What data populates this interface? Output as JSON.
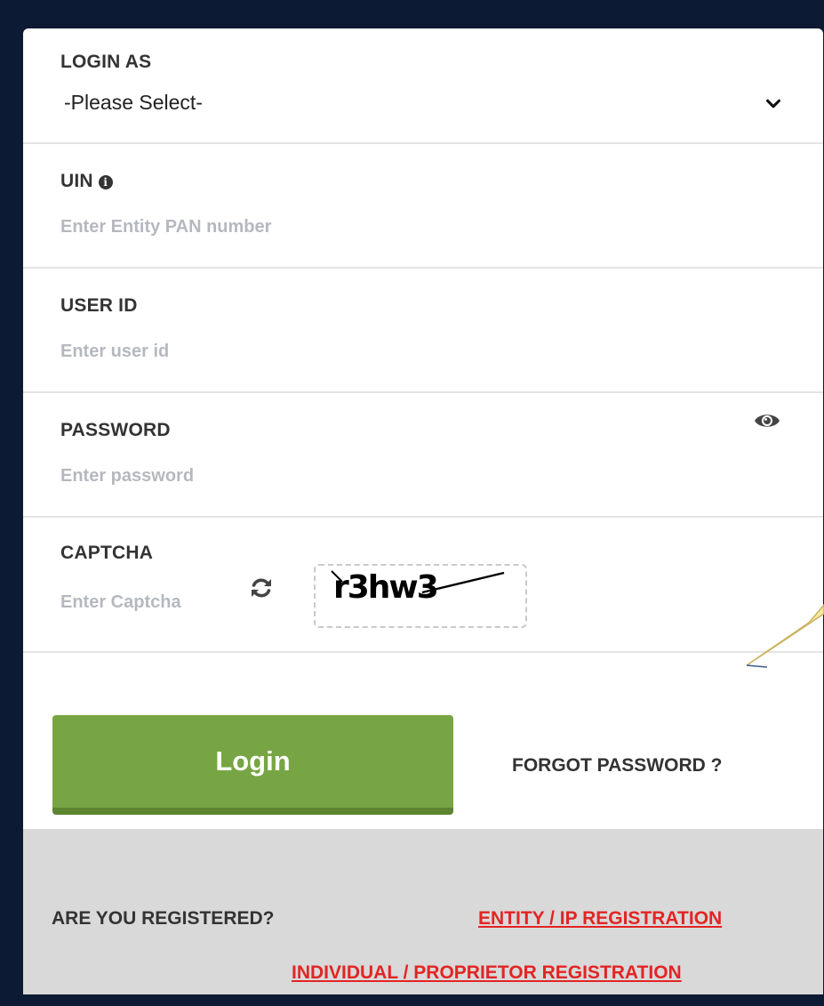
{
  "login_as": {
    "label": "LOGIN AS",
    "selected": "-Please Select-",
    "chevron_icon": "chevron-down-icon"
  },
  "uin": {
    "label": "UIN",
    "info_icon": "info-circle-icon",
    "placeholder": "Enter Entity PAN number"
  },
  "user_id": {
    "label": "USER ID",
    "placeholder": "Enter user id"
  },
  "password": {
    "label": "PASSWORD",
    "placeholder": "Enter password",
    "toggle_icon": "eye-icon"
  },
  "captcha": {
    "label": "CAPTCHA",
    "placeholder": "Enter Captcha",
    "refresh_icon": "refresh-icon",
    "image_text": "r3hw3"
  },
  "actions": {
    "login_label": "Login",
    "forgot_label": "FORGOT PASSWORD ?"
  },
  "footer": {
    "question": "ARE YOU REGISTERED?",
    "entity_link": "ENTITY / IP REGISTRATION",
    "individual_link": "INDIVIDUAL / PROPRIETOR REGISTRATION"
  },
  "colors": {
    "login_button": "#78a544",
    "link_red": "#e32424",
    "frame_navy": "#0d1a33",
    "footer_gray": "#d9d9d9"
  }
}
